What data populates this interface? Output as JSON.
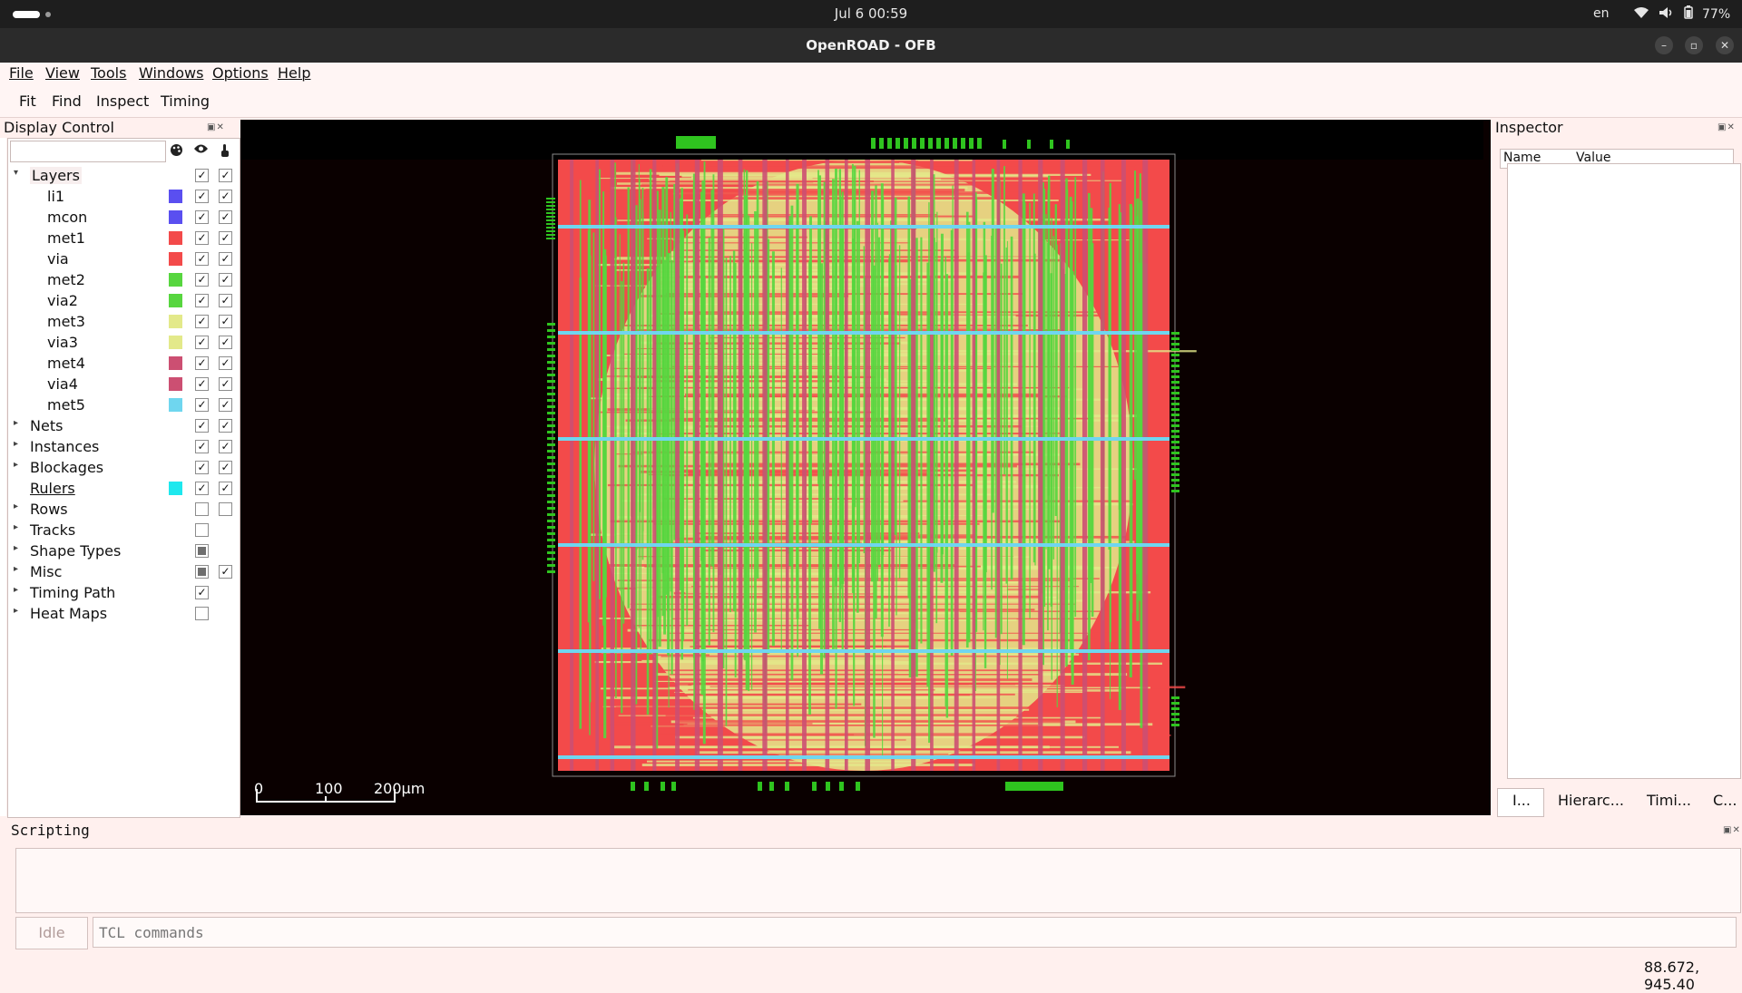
{
  "system_bar": {
    "clock": "Jul 6  00:59",
    "lang": "en",
    "battery": "77%"
  },
  "window": {
    "title": "OpenROAD - OFB"
  },
  "menubar": {
    "items": [
      "File",
      "View",
      "Tools",
      "Windows",
      "Options",
      "Help"
    ]
  },
  "toolbar": {
    "items": [
      "Fit",
      "Find",
      "Inspect",
      "Timing"
    ]
  },
  "display_control": {
    "title": "Display Control",
    "tree": [
      {
        "label": "Layers",
        "expanded": true,
        "color": null,
        "visible": "checked",
        "selectable": "checked"
      },
      {
        "label": "li1",
        "child": true,
        "color": "#5a4ff0",
        "visible": "checked",
        "selectable": "checked"
      },
      {
        "label": "mcon",
        "child": true,
        "color": "#5a4ff0",
        "visible": "checked",
        "selectable": "checked"
      },
      {
        "label": "met1",
        "child": true,
        "color": "#f34a4a",
        "visible": "checked",
        "selectable": "checked"
      },
      {
        "label": "via",
        "child": true,
        "color": "#f34a4a",
        "visible": "checked",
        "selectable": "checked"
      },
      {
        "label": "met2",
        "child": true,
        "color": "#57d63f",
        "visible": "checked",
        "selectable": "checked"
      },
      {
        "label": "via2",
        "child": true,
        "color": "#57d63f",
        "visible": "checked",
        "selectable": "checked"
      },
      {
        "label": "met3",
        "child": true,
        "color": "#e3e98a",
        "visible": "checked",
        "selectable": "checked"
      },
      {
        "label": "via3",
        "child": true,
        "color": "#e3e98a",
        "visible": "checked",
        "selectable": "checked"
      },
      {
        "label": "met4",
        "child": true,
        "color": "#cc4f72",
        "visible": "checked",
        "selectable": "checked"
      },
      {
        "label": "via4",
        "child": true,
        "color": "#cc4f72",
        "visible": "checked",
        "selectable": "checked"
      },
      {
        "label": "met5",
        "child": true,
        "color": "#6fd6ef",
        "visible": "checked",
        "selectable": "checked"
      },
      {
        "label": "Nets",
        "expandable": true,
        "color": null,
        "visible": "checked",
        "selectable": "checked"
      },
      {
        "label": "Instances",
        "expandable": true,
        "color": null,
        "visible": "checked",
        "selectable": "checked"
      },
      {
        "label": "Blockages",
        "expandable": true,
        "color": null,
        "visible": "checked",
        "selectable": "checked"
      },
      {
        "label": "Rulers",
        "color": "#1ee8ee",
        "visible": "checked",
        "selectable": "checked",
        "underline": true
      },
      {
        "label": "Rows",
        "expandable": true,
        "color": null,
        "visible": "unchecked",
        "selectable": "unchecked"
      },
      {
        "label": "Tracks",
        "expandable": true,
        "color": null,
        "visible": "unchecked",
        "selectable": null
      },
      {
        "label": "Shape Types",
        "expandable": true,
        "color": null,
        "visible": "partial",
        "selectable": null
      },
      {
        "label": "Misc",
        "expandable": true,
        "color": null,
        "visible": "partial",
        "selectable": "checked"
      },
      {
        "label": "Timing Path",
        "expandable": true,
        "color": null,
        "visible": "checked",
        "selectable": null
      },
      {
        "label": "Heat Maps",
        "expandable": true,
        "color": null,
        "visible": "unchecked",
        "selectable": null
      }
    ]
  },
  "layout_view": {
    "scale_labels": [
      "0",
      "100",
      "200μm"
    ],
    "colors": {
      "background": "#0a0000",
      "met1": "#f34a4a",
      "met2": "#57d63f",
      "met3": "#e3e98a",
      "met4": "#cc4f72",
      "met5": "#6fd6ef"
    }
  },
  "inspector": {
    "title": "Inspector",
    "columns": [
      "Name",
      "Value"
    ],
    "tabs": [
      "I...",
      "Hierarc...",
      "Timi...",
      "C..."
    ]
  },
  "scripting": {
    "title": "Scripting",
    "status": "Idle",
    "input_placeholder": "TCL commands"
  },
  "status_bar": {
    "coordinates": "88.672, 945.40"
  }
}
